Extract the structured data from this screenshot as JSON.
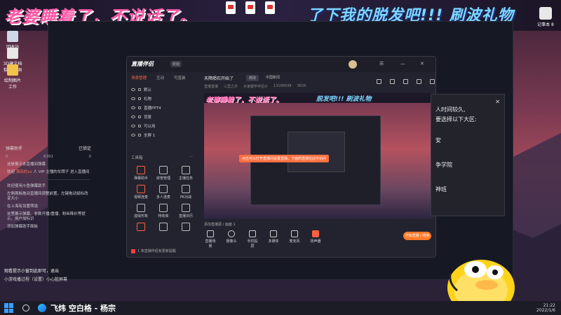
{
  "banner": {
    "left_text": "老婆睡着了，不说话了。",
    "right_text": "了下我的脱发吧!!!  刷波礼物",
    "file_labels": [
      "",
      "",
      ""
    ]
  },
  "desktop": {
    "left_icons": [
      {
        "label": "回收站"
      },
      {
        "label": "3D建文档软件\n脑洞"
      },
      {
        "label": "绘制图片工作"
      }
    ],
    "right_icon_label": "记事本 8"
  },
  "chat": {
    "title": "弹幕助手",
    "status": "已锁定",
    "stats": {
      "viewers": "0",
      "likes": "6391",
      "gifts": "0"
    },
    "lines": [
      {
        "prefix": "",
        "text": "这是展示本直播间弹幕"
      },
      {
        "prefix": "欢迎",
        "name": "漂亮的xx",
        "suffix": "人 VIP 主播的车牌子 进入直播间"
      }
    ],
    "lines2": [
      "欢迎使用斗鱼弹幕助手",
      "左侧面板拖动直播间调整前置，左键拖动鼠标改变大小",
      "在上海有设置筛选",
      "这里展示弹幕、参数开播/重播、粉丝降价等提示，用户加标识",
      "添加弹幕助手面板"
    ]
  },
  "notice": {
    "line1": "观看提示小窗到此即可，退出",
    "line2": "小游戏播过程（设置）小心脏屏幕"
  },
  "app": {
    "logo": "直播伴侣",
    "version_badge": "新版",
    "tabs": [
      "场景管理",
      "互动",
      "可直装"
    ],
    "scenes": [
      "默认",
      "礼物",
      "直播PPT4",
      "背景",
      "可以用",
      "全屏 1"
    ],
    "tools_title": "工具箱",
    "tools": [
      {
        "label": "弹幕助手",
        "red": true
      },
      {
        "label": "房管管理",
        "red": false
      },
      {
        "label": "主播任务",
        "red": false
      },
      {
        "label": "视频连麦",
        "red": false
      },
      {
        "label": "多人连麦",
        "red": false
      },
      {
        "label": "PK对战",
        "red": false
      },
      {
        "label": "虚拟形象",
        "red": false
      },
      {
        "label": "特效库",
        "red": false
      },
      {
        "label": "直播日历",
        "red": false
      },
      {
        "label": "",
        "red": true
      },
      {
        "label": "",
        "red": false
      },
      {
        "label": "",
        "red": false
      }
    ],
    "tools_footer": "1 条直播伴侣有更新提醒",
    "room": {
      "title": "天降陨石开始了",
      "tag": "修改",
      "category": "中国新闻",
      "meta": [
        "直播直播",
        "三里之外",
        "大家都学伴侣子",
        "13189548",
        "3828"
      ]
    },
    "preview": {
      "banner_left": "老婆睡着了，不说话了。",
      "banner_right": "脱发吧!!! 刷波礼物",
      "toast": "点击可以打开直播间设置直播，下面的直播在此中访问"
    },
    "toolbar": {
      "source": "添加直播源 / 画面 1",
      "items": [
        {
          "label": "直播场景",
          "shape": "square",
          "red": false
        },
        {
          "label": "摄像头",
          "shape": "round",
          "red": false
        },
        {
          "label": "手机投屏",
          "shape": "square",
          "red": false
        },
        {
          "label": "多媒体",
          "shape": "square",
          "red": false
        },
        {
          "label": "麦克风",
          "shape": "square",
          "red": false
        },
        {
          "label": "扬声器",
          "shape": "square",
          "red": true
        }
      ],
      "live_button": "开始直播 / 结束"
    }
  },
  "dialog": {
    "lines": [
      "人时间较久,",
      "要选择以下大区:",
      "安",
      "争学院",
      "神班"
    ]
  },
  "taskbar": {
    "song": "飞炜 空白格 - 杨宗",
    "time": "21:22",
    "date": "2022/1/6"
  }
}
